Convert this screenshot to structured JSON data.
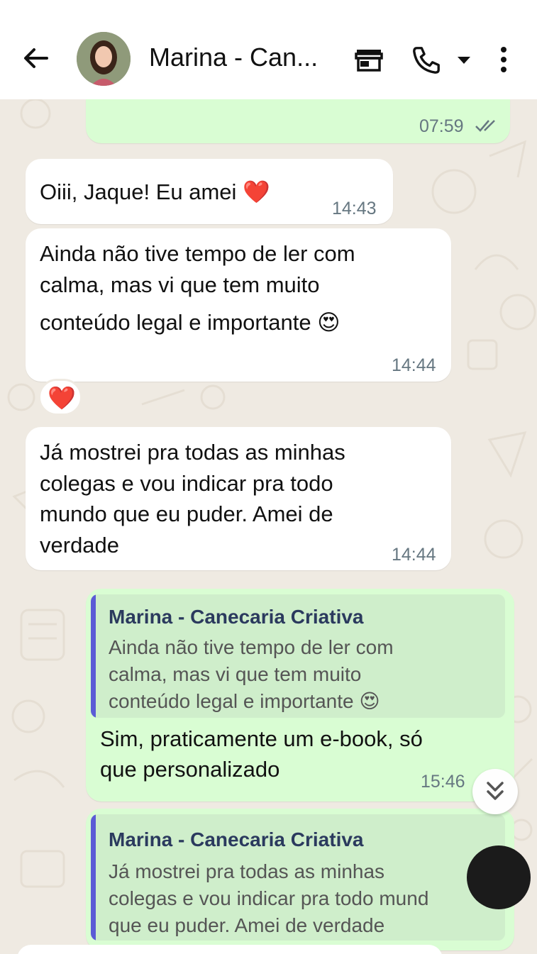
{
  "contact": {
    "name": "Marina - Can..."
  },
  "header_icons": [
    "back-arrow-icon",
    "shop-icon",
    "phone-icon",
    "dropdown-icon",
    "more-icon"
  ],
  "messages": [
    {
      "type": "out",
      "time": "07:59",
      "status": "read"
    },
    {
      "type": "in",
      "text": "Oiii, Jaque! Eu amei ❤️",
      "time": "14:43"
    },
    {
      "type": "in",
      "lines": [
        "Ainda não tive tempo de ler com",
        "calma, mas vi que tem muito",
        "conteúdo legal e importante 😍"
      ],
      "time": "14:44",
      "reaction": "❤️"
    },
    {
      "type": "in",
      "lines": [
        "Já mostrei pra todas as minhas",
        "colegas e vou indicar pra todo",
        "mundo que eu puder. Amei de",
        "verdade"
      ],
      "time": "14:44"
    },
    {
      "type": "out",
      "quote": {
        "author": "Marina - Canecaria Criativa",
        "lines": [
          "Ainda não tive tempo de ler com",
          "calma, mas vi que tem muito",
          "conteúdo legal e importante 😍"
        ]
      },
      "lines": [
        "Sim, praticamente  um e-book, só",
        "que personalizado"
      ],
      "time": "15:46",
      "status": "read"
    },
    {
      "type": "out",
      "quote": {
        "author": "Marina - Canecaria Criativa",
        "lines": [
          "Já mostrei pra todas as minhas",
          "colegas e vou indicar pra todo mund",
          "que eu puder. Amei de verdade"
        ]
      }
    }
  ],
  "colors": {
    "incoming": "#ffffff",
    "outgoing": "#d9fdd3",
    "background": "#efeae2",
    "quote_bar": "#5b5bd6",
    "read_ticks": "#667781"
  }
}
